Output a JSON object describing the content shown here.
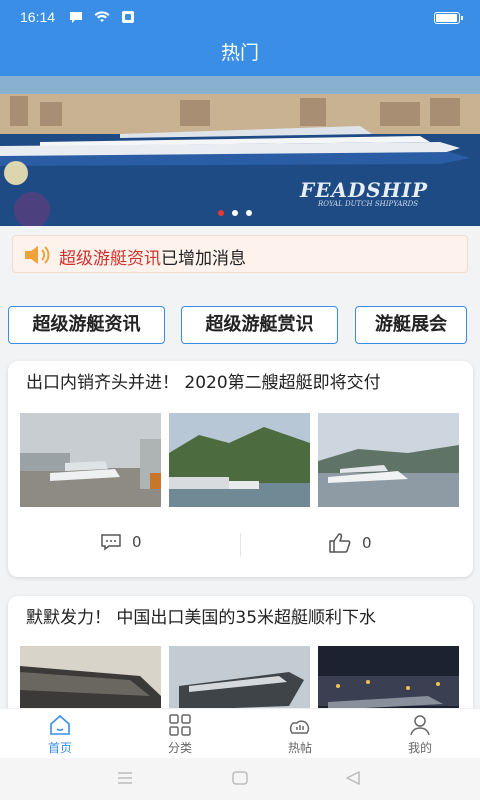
{
  "status_bar": {
    "time": "16:14",
    "battery_level": 1.0
  },
  "header": {
    "title": "热门"
  },
  "banner": {
    "brand_text": "FEADSHIP",
    "brand_sub": "ROYAL DUTCH SHIPYARDS",
    "slide_count": 3,
    "active_slide": 1
  },
  "notice": {
    "highlight": "超级游艇资讯",
    "text": "已增加消息",
    "icon": "speaker-icon"
  },
  "categories": [
    {
      "label": "超级游艇资讯"
    },
    {
      "label": "超级游艇赏识"
    },
    {
      "label": "游艇展会"
    }
  ],
  "articles": [
    {
      "title": "出口内销齐头并进！ 2020第二艘超艇即将交付",
      "comments": "0",
      "likes": "0"
    },
    {
      "title": "默默发力！ 中国出口美国的35米超艇顺利下水"
    }
  ],
  "tabbar": {
    "items": [
      {
        "label": "首页",
        "icon": "home-icon",
        "active": true
      },
      {
        "label": "分类",
        "icon": "grid-icon",
        "active": false
      },
      {
        "label": "热帖",
        "icon": "hot-icon",
        "active": false
      },
      {
        "label": "我的",
        "icon": "user-icon",
        "active": false
      }
    ]
  },
  "colors": {
    "primary": "#3a8ee6",
    "highlight": "#d0312d",
    "notice_bg": "#fdf3ec"
  }
}
